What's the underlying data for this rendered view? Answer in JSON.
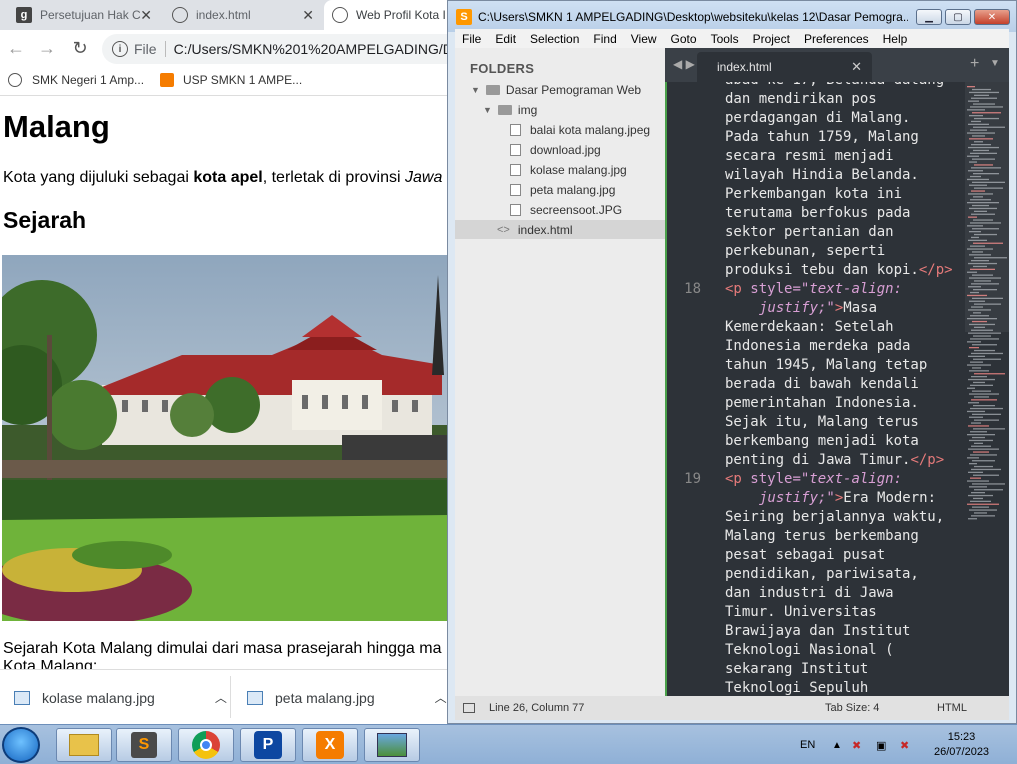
{
  "browser": {
    "tabs": [
      {
        "label": "Persetujuan Hak C",
        "favicon": "globe-icon"
      },
      {
        "label": "index.html",
        "favicon": "globe-icon"
      },
      {
        "label": "Web Profil Kota I",
        "favicon": "globe-icon"
      }
    ],
    "address": {
      "scheme": "File",
      "url": "C:/Users/SMKN%201%20AMPELGADING/De"
    },
    "bookmarks": [
      "SMK Negeri 1 Amp...",
      "USP SMKN 1 AMPE..."
    ]
  },
  "page": {
    "h1": "Malang",
    "intro_prefix": "Kota yang dijuluki sebagai ",
    "intro_bold": "kota apel",
    "intro_mid": ", terletak di provinsi ",
    "intro_italic": "Jawa",
    "h2": "Sejarah",
    "para_line1": "Sejarah Kota Malang dimulai dari masa prasejarah hingga ma",
    "para_line2": "Kota Malang:"
  },
  "downloads": [
    {
      "name": "kolase malang.jpg"
    },
    {
      "name": "peta malang.jpg"
    }
  ],
  "sublime": {
    "title": "C:\\Users\\SMKN 1 AMPELGADING\\Desktop\\websiteku\\kelas 12\\Dasar Pemogra...",
    "menu": [
      "File",
      "Edit",
      "Selection",
      "Find",
      "View",
      "Goto",
      "Tools",
      "Project",
      "Preferences",
      "Help"
    ],
    "folders_label": "FOLDERS",
    "root_folder": "Dasar Pemograman Web",
    "sub_folder": "img",
    "files": [
      "balai kota malang.jpeg",
      "download.jpg",
      "kolase malang.jpg",
      "peta malang.jpg",
      "secreensoot.JPG"
    ],
    "open_file": "index.html",
    "tab_label": "index.html",
    "status_left": "Line 26, Column 77",
    "tab_size": "Tab Size: 4",
    "syntax": "HTML",
    "code_lines": [
      {
        "num": "",
        "text": "abad ke-17, Belanda datang"
      },
      {
        "num": "",
        "text": "dan mendirikan pos"
      },
      {
        "num": "",
        "text": "perdagangan di Malang."
      },
      {
        "num": "",
        "text": "Pada tahun 1759, Malang"
      },
      {
        "num": "",
        "text": "secara resmi menjadi"
      },
      {
        "num": "",
        "text": "wilayah Hindia Belanda."
      },
      {
        "num": "",
        "text": "Perkembangan kota ini"
      },
      {
        "num": "",
        "text": "terutama berfokus pada"
      },
      {
        "num": "",
        "text": "sektor pertanian dan"
      },
      {
        "num": "",
        "text": "perkebunan, seperti"
      },
      {
        "num": "",
        "text": "produksi tebu dan kopi.",
        "tail": "</p>"
      },
      {
        "num": "18",
        "tag": "<p ",
        "attr": "style=",
        "val": "\"text-align:"
      },
      {
        "num": "",
        "indent": true,
        "val2": "justify;\"",
        "tag2": ">",
        "text": "Masa"
      },
      {
        "num": "",
        "text": "Kemerdekaan: Setelah"
      },
      {
        "num": "",
        "text": "Indonesia merdeka pada"
      },
      {
        "num": "",
        "text": "tahun 1945, Malang tetap"
      },
      {
        "num": "",
        "text": "berada di bawah kendali"
      },
      {
        "num": "",
        "text": "pemerintahan Indonesia."
      },
      {
        "num": "",
        "text": "Sejak itu, Malang terus"
      },
      {
        "num": "",
        "text": "berkembang menjadi kota"
      },
      {
        "num": "",
        "text": "penting di Jawa Timur.",
        "tail": "</p>"
      },
      {
        "num": "19",
        "tag": "<p ",
        "attr": "style=",
        "val": "\"text-align:"
      },
      {
        "num": "",
        "indent": true,
        "val2": "justify;\"",
        "tag2": ">",
        "text": "Era Modern:"
      },
      {
        "num": "",
        "text": "Seiring berjalannya waktu,"
      },
      {
        "num": "",
        "text": "Malang terus berkembang"
      },
      {
        "num": "",
        "text": "pesat sebagai pusat"
      },
      {
        "num": "",
        "text": "pendidikan, pariwisata,"
      },
      {
        "num": "",
        "text": "dan industri di Jawa"
      },
      {
        "num": "",
        "text": "Timur. Universitas"
      },
      {
        "num": "",
        "text": "Brawijaya dan Institut"
      },
      {
        "num": "",
        "text": "Teknologi Nasional ("
      },
      {
        "num": "",
        "text": "sekarang Institut"
      },
      {
        "num": "",
        "text": "Teknologi Sepuluh"
      }
    ]
  },
  "taskbar": {
    "lang": "EN",
    "time": "15:23",
    "date": "26/07/2023",
    "apps": [
      "explorer-icon",
      "sublime-icon",
      "chrome-icon",
      "pdf-app-icon",
      "xampp-icon",
      "photo-viewer-icon"
    ]
  }
}
